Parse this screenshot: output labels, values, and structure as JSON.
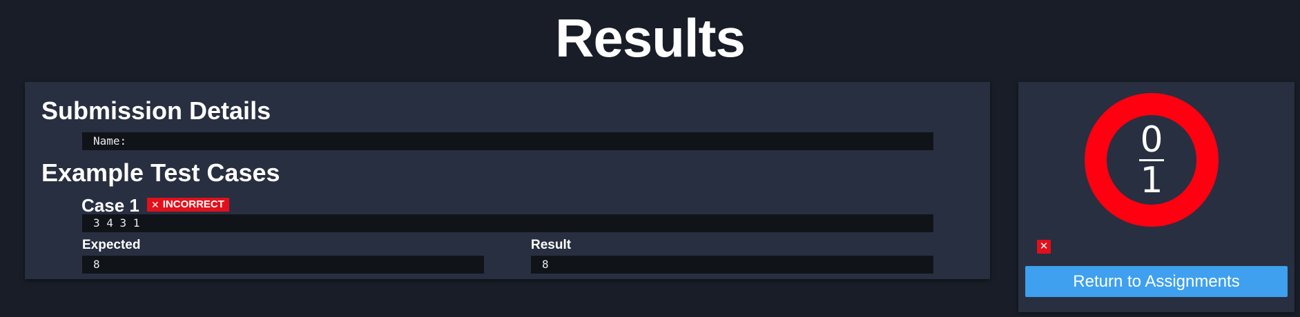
{
  "page": {
    "title": "Results"
  },
  "submission": {
    "heading": "Submission Details",
    "name_line": "Name:"
  },
  "tests": {
    "heading": "Example Test Cases",
    "cases": [
      {
        "title": "Case 1",
        "status": "INCORRECT",
        "status_icon": "close-icon",
        "input": "3 4 3 1",
        "expected_label": "Expected",
        "expected": "8",
        "result_label": "Result",
        "result": "8"
      }
    ]
  },
  "score": {
    "earned": "0",
    "total": "1",
    "ring_color": "#ff0011",
    "status_icon": "close-icon"
  },
  "actions": {
    "return_label": "Return to Assignments"
  },
  "colors": {
    "background": "#181d27",
    "panel": "#282f40",
    "code_bar": "#101318",
    "incorrect": "#e3101b",
    "button": "#3ea0ee"
  }
}
